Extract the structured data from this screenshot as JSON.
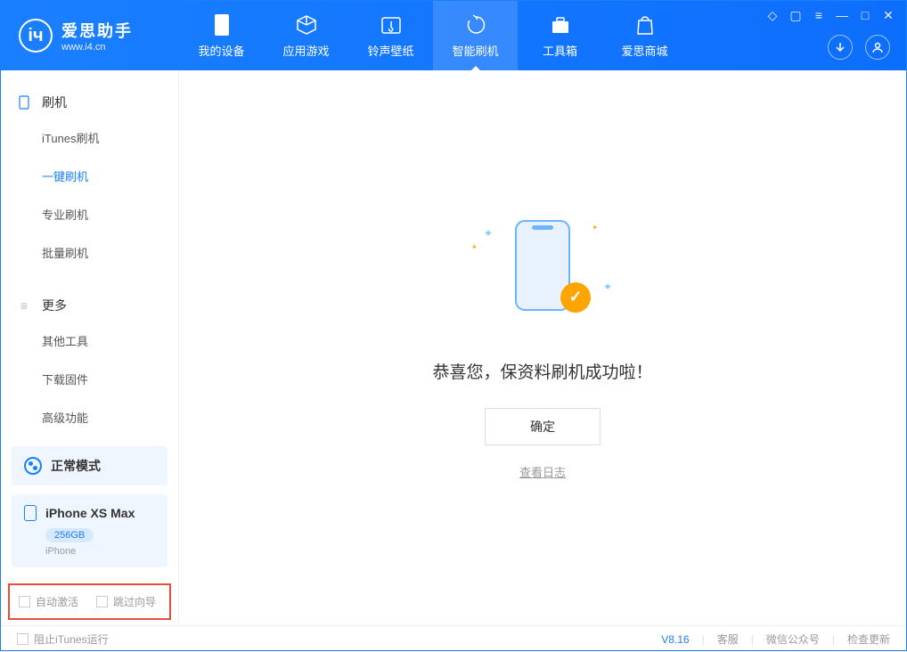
{
  "app": {
    "title": "爱思助手",
    "url": "www.i4.cn"
  },
  "nav": [
    {
      "label": "我的设备"
    },
    {
      "label": "应用游戏"
    },
    {
      "label": "铃声壁纸"
    },
    {
      "label": "智能刷机"
    },
    {
      "label": "工具箱"
    },
    {
      "label": "爱思商城"
    }
  ],
  "sidebar": {
    "section1_title": "刷机",
    "items1": [
      {
        "label": "iTunes刷机"
      },
      {
        "label": "一键刷机"
      },
      {
        "label": "专业刷机"
      },
      {
        "label": "批量刷机"
      }
    ],
    "section2_title": "更多",
    "items2": [
      {
        "label": "其他工具"
      },
      {
        "label": "下载固件"
      },
      {
        "label": "高级功能"
      }
    ]
  },
  "device": {
    "mode": "正常模式",
    "name": "iPhone XS Max",
    "capacity": "256GB",
    "type": "iPhone"
  },
  "checkboxes": {
    "auto_activate": "自动激活",
    "skip_guide": "跳过向导"
  },
  "main": {
    "success_title": "恭喜您，保资料刷机成功啦！",
    "confirm": "确定",
    "view_log": "查看日志"
  },
  "footer": {
    "block_itunes": "阻止iTunes运行",
    "version": "V8.16",
    "support": "客服",
    "wechat": "微信公众号",
    "check_update": "检查更新"
  }
}
